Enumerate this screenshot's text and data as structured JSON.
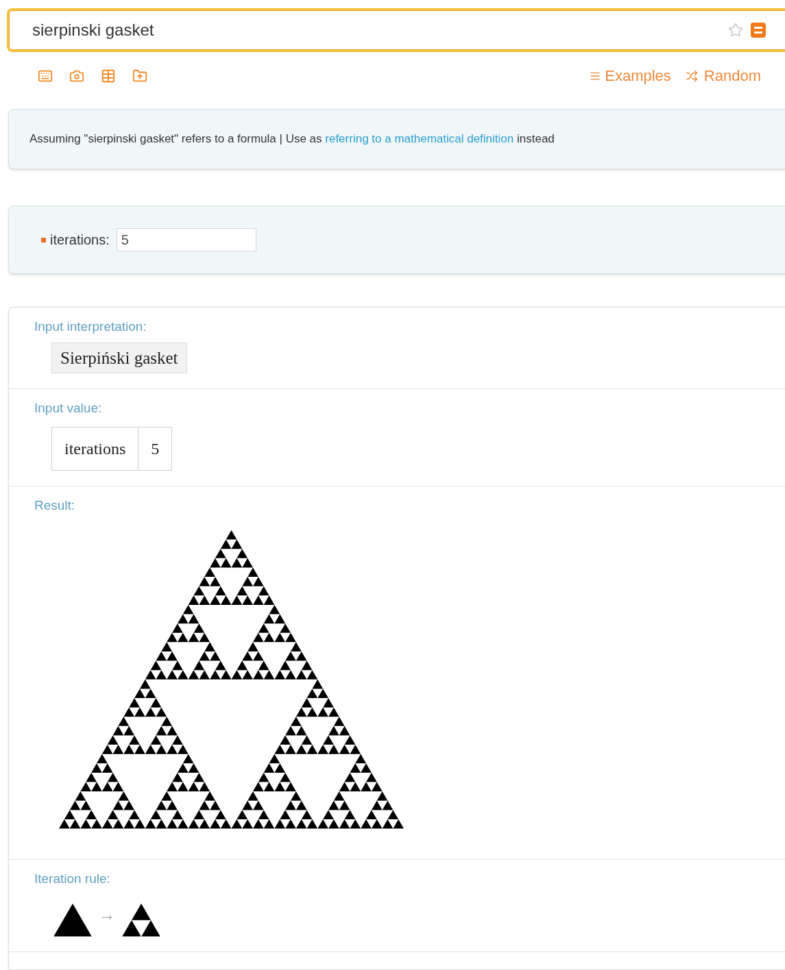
{
  "search": {
    "value": "sierpinski gasket"
  },
  "toolbar": {
    "links": [
      {
        "kind": "examples",
        "label": "Examples"
      },
      {
        "kind": "random",
        "label": "Random"
      }
    ]
  },
  "assumption": {
    "text": "Assuming \"sierpinski gasket\" refers to a formula | Use as",
    "link": "referring to a mathematical definition",
    "suffix": "instead"
  },
  "parameters": [
    {
      "label": "iterations:",
      "value": "5"
    }
  ],
  "pods": [
    {
      "kind": "interpretation",
      "title": "Input interpretation:",
      "value": "Sierpiński gasket"
    },
    {
      "kind": "table",
      "title": "Input value:",
      "cells": [
        "iterations",
        "5"
      ]
    },
    {
      "kind": "fractal",
      "title": "Result:"
    },
    {
      "kind": "rule",
      "title": "Iteration rule:",
      "arrow": "→"
    }
  ]
}
